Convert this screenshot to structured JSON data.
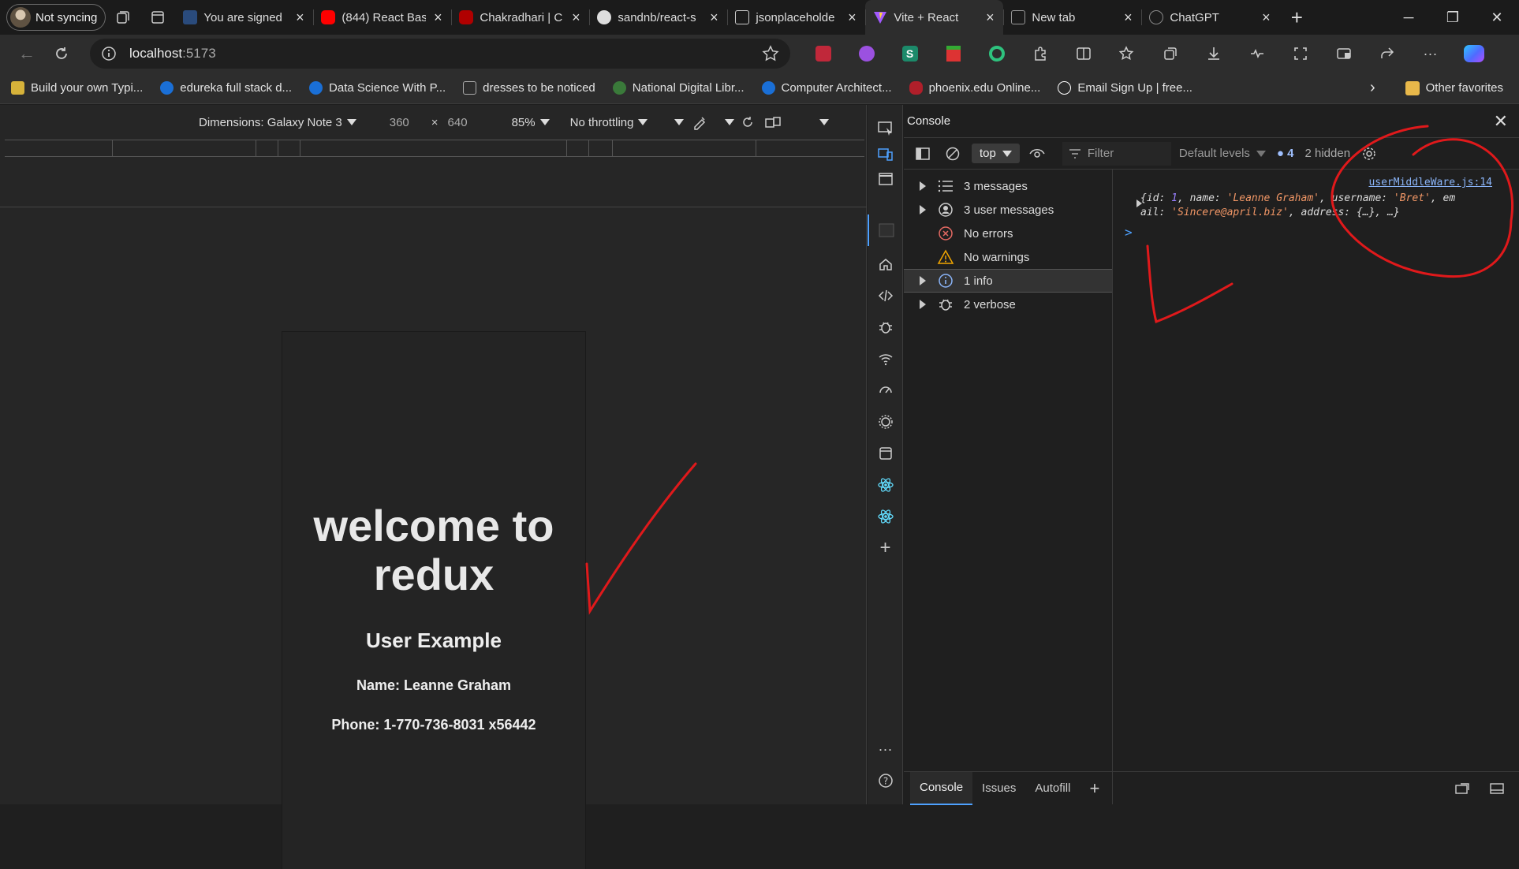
{
  "profile": {
    "label": "Not syncing"
  },
  "tabs": [
    {
      "title": "You are signed",
      "favicon_color": "#2a4b7c"
    },
    {
      "title": "(844) React Bas",
      "favicon_color": "#ff0000"
    },
    {
      "title": "Chakradhari | C",
      "favicon_color": "#b00000"
    },
    {
      "title": "sandnb/react-s",
      "favicon_color": "#dddddd"
    },
    {
      "title": "jsonplaceholde",
      "favicon_color": "#cccccc"
    },
    {
      "title": "Vite + React",
      "favicon_color": "#a259ff"
    },
    {
      "title": "New tab",
      "favicon_color": "#999999"
    },
    {
      "title": "ChatGPT",
      "favicon_color": "#888888"
    }
  ],
  "address": {
    "host": "localhost",
    "port": ":5173"
  },
  "bookmarks": [
    {
      "label": "Build your own Typi...",
      "color": "#d6b23a"
    },
    {
      "label": "edureka full stack d...",
      "color": "#1a6fd6"
    },
    {
      "label": "Data Science With P...",
      "color": "#1a6fd6"
    },
    {
      "label": "dresses to be noticed",
      "color": "#aaaaaa"
    },
    {
      "label": "National Digital Libr...",
      "color": "#3a7a3a"
    },
    {
      "label": "Computer Architect...",
      "color": "#1a6fd6"
    },
    {
      "label": "phoenix.edu Online...",
      "color": "#b01f2a"
    },
    {
      "label": "Email Sign Up | free...",
      "color": "#ffffff"
    }
  ],
  "other_favorites": "Other favorites",
  "device_toolbar": {
    "dimensions": "Dimensions: Galaxy Note 3",
    "width": "360",
    "times": "×",
    "height": "640",
    "zoom": "85%",
    "throttling": "No throttling"
  },
  "app": {
    "heading": "welcome to redux",
    "subheading": "User Example",
    "name_line": "Name: Leanne Graham",
    "phone_line": "Phone: 1-770-736-8031 x56442"
  },
  "console": {
    "title": "Console",
    "context": "top",
    "filter_placeholder": "Filter",
    "levels": "Default levels",
    "message_count": "4",
    "hidden": "2 hidden",
    "sidebar": [
      {
        "label": "3 messages",
        "icon": "list-icon",
        "expandable": true
      },
      {
        "label": "3 user messages",
        "icon": "user-icon",
        "expandable": true
      },
      {
        "label": "No errors",
        "icon": "error-icon",
        "expandable": false
      },
      {
        "label": "No warnings",
        "icon": "warning-icon",
        "expandable": false
      },
      {
        "label": "1 info",
        "icon": "info-icon",
        "expandable": true
      },
      {
        "label": "2 verbose",
        "icon": "bug-icon",
        "expandable": true
      }
    ],
    "log_source": "userMiddleWare.js:14",
    "log_prefix": "{id: ",
    "log_id": "1",
    "log_mid1": ", name: ",
    "log_name": "'Leanne Graham'",
    "log_mid2": ", username: ",
    "log_username": "'Bret'",
    "log_mid3": ", em",
    "log_line2a": "ail: ",
    "log_email": "'Sincere@april.biz'",
    "log_line2b": ", address: {…}, …}",
    "prompt": ">"
  },
  "drawer_tabs": [
    "Console",
    "Issues",
    "Autofill"
  ],
  "colors": {
    "annotation": "#e0191b",
    "accent": "#4ea1ff"
  }
}
